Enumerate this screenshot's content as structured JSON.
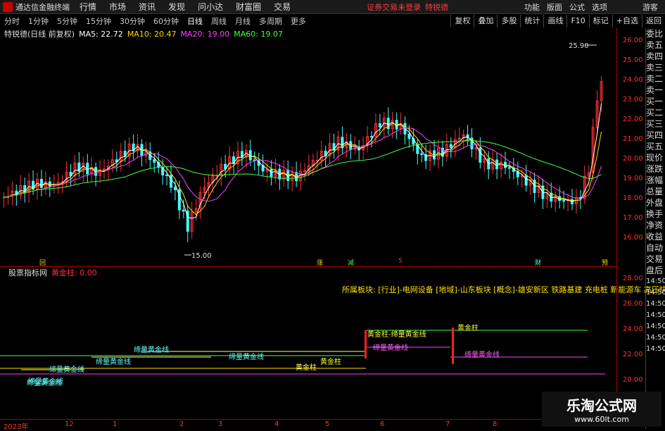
{
  "menubar": {
    "app": "通达信金融终端",
    "items": [
      "行情",
      "市场",
      "资讯",
      "发现",
      "问小达",
      "财富圈",
      "交易"
    ],
    "warning": "证券交易未登录",
    "stock": "特锐德",
    "right": [
      "功能",
      "版面",
      "公式",
      "选项",
      "游客"
    ]
  },
  "tabs": [
    "分时",
    "1分钟",
    "5分钟",
    "15分钟",
    "30分钟",
    "60分钟",
    "日线",
    "周线",
    "月线",
    "多周期",
    "更多"
  ],
  "tools": [
    "复权",
    "叠加",
    "多股",
    "统计",
    "画线",
    "F10",
    "标记",
    "+自选",
    "返回"
  ],
  "info": {
    "name": "特锐德(日线 前复权)",
    "ma5": "MA5: 22.72",
    "ma10": "MA10: 20.47",
    "ma20": "MA20: 19.00",
    "ma60": "MA60: 19.07"
  },
  "colors": {
    "ma5": "#ffffff",
    "ma10": "#ffd800",
    "ma20": "#ff40ff",
    "ma60": "#40ff40",
    "up": "#ff3030",
    "down": "#40ffff",
    "axis": "#ff3030"
  },
  "yaxis": [
    "26.00",
    "25.00",
    "24.00",
    "23.00",
    "22.00",
    "21.00",
    "20.00",
    "19.00",
    "18.00",
    "17.00",
    "16.00"
  ],
  "high_label": "25.90",
  "low_label": "15.00",
  "side": [
    "委比",
    "卖五",
    "卖四",
    "卖三",
    "卖二",
    "卖一",
    "买一",
    "买二",
    "买三",
    "买四",
    "买五",
    "现价",
    "涨跌",
    "涨幅",
    "总量",
    "外盘",
    "换手",
    "净资",
    "收益",
    "自动",
    "交易",
    "盘后",
    "14:50",
    "14:50",
    "14:50",
    "14:50",
    "14:50",
    "14:50",
    "14:50"
  ],
  "indicator": {
    "title": "股票指标网",
    "name": "黄金柱: 0.00",
    "blocks": "所属板块: [行业]-电网设备 [地域]-山东板块 [概念]-雄安新区 铁路基建 充电桩 新能源车 高压快",
    "yaxis": [
      "28.00",
      "26.00",
      "24.00",
      "22.00",
      "20.00",
      "18.00"
    ],
    "labels": [
      {
        "t": "缔量黄金线",
        "c": "#60ffff"
      },
      {
        "t": "缔量黄金线",
        "c": "#60ffff"
      },
      {
        "t": "缔量黄金线",
        "c": "#60ffff"
      },
      {
        "t": "缔量黄金线",
        "c": "#60ffff"
      },
      {
        "t": "缔量黄金线",
        "c": "#60ffff"
      },
      {
        "t": "缔量黄金线",
        "c": "#60ffff"
      },
      {
        "t": "黄金柱",
        "c": "#ffff40"
      },
      {
        "t": "黄金柱",
        "c": "#ffff40"
      },
      {
        "t": "黄金柱-缔量黄金线",
        "c": "#ffff40"
      },
      {
        "t": "缔量黄金线",
        "c": "#ff60ff"
      },
      {
        "t": "黄金柱",
        "c": "#ffff40"
      },
      {
        "t": "缔量黄金线",
        "c": "#ff60ff"
      }
    ]
  },
  "xaxis": [
    "2023年",
    "12",
    "1",
    "2",
    "3",
    "4",
    "5",
    "6",
    "7",
    "8"
  ],
  "markers": [
    "回",
    "涨",
    "减",
    "5",
    "财",
    "预"
  ],
  "watermark": {
    "t1": "乐淘公式网",
    "t2": "www.60lt.com"
  }
}
